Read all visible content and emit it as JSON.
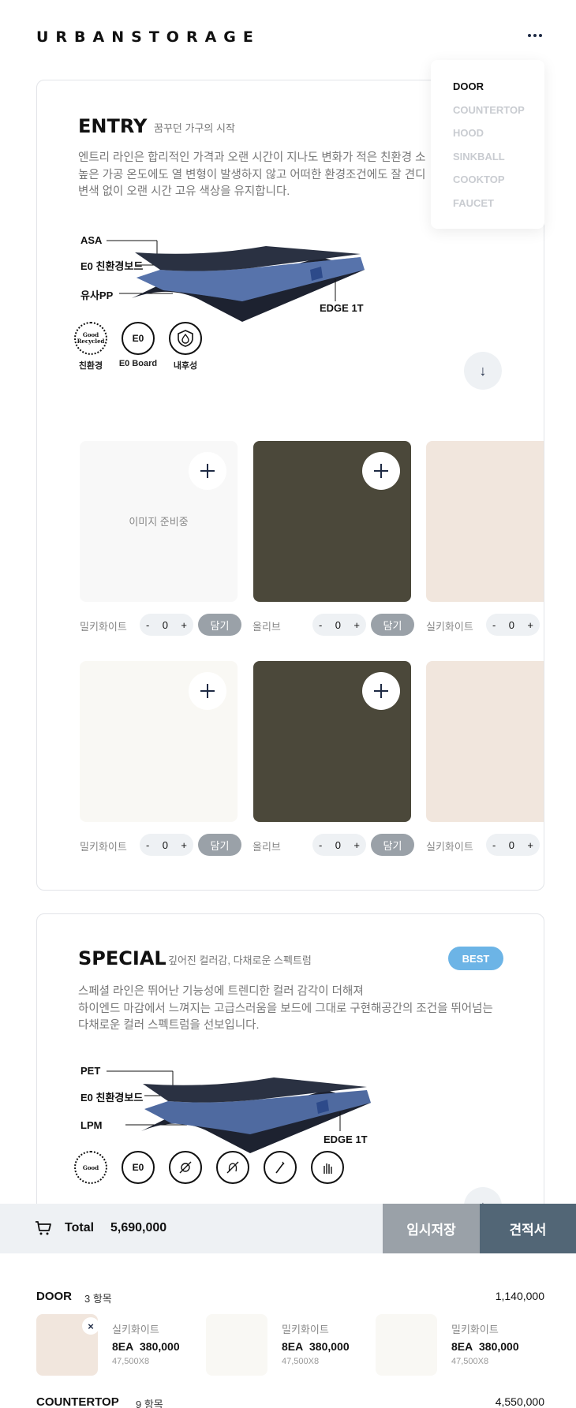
{
  "brand": {
    "logo": "URBANSTORAGE"
  },
  "menu": {
    "items": [
      "DOOR",
      "COUNTERTOP",
      "HOOD",
      "SINKBALL",
      "COOKTOP",
      "FAUCET"
    ],
    "active": "DOOR"
  },
  "entry": {
    "title": "ENTRY",
    "subtitle": "꿈꾸던 가구의 시작",
    "desc": [
      "엔트리 라인은 합리적인 가격과 오랜 시간이 지나도 변화가 적은 친환경 소",
      "높은 가공 온도에도 열 변형이 발생하지 않고 어떠한 환경조건에도 잘 견디",
      "변색 없이 오랜 시간 고유 색상을 유지합니다."
    ],
    "layers": [
      "ASA",
      "E0 친환경보드",
      "유사PP",
      "EDGE 1T"
    ],
    "certs": [
      {
        "icon": "good-recycled-icon",
        "label": "Good Recycled",
        "caption": "친환경"
      },
      {
        "icon": "e0-icon",
        "label": "E0",
        "caption": "E0 Board"
      },
      {
        "icon": "shield-drop-icon",
        "label": "",
        "caption": "내후성"
      }
    ],
    "placeholder": "이미지 준비중",
    "add_label": "담기",
    "options_row1": [
      {
        "name": "밀키화이트",
        "qty": "0",
        "color": "#f8f8f8"
      },
      {
        "name": "올리브",
        "qty": "0",
        "color": "#4b483a"
      },
      {
        "name": "실키화이트",
        "qty": "0",
        "color": "#f1e6dd"
      }
    ],
    "options_row2": [
      {
        "name": "밀키화이트",
        "qty": "0",
        "color": "#f9f8f4"
      },
      {
        "name": "올리브",
        "qty": "0",
        "color": "#4b483a"
      },
      {
        "name": "실키화이트",
        "qty": "0",
        "color": "#f1e6dd"
      }
    ]
  },
  "special": {
    "title": "SPECIAL",
    "subtitle": "깊어진 컬러감, 다채로운 스펙트럼",
    "badge": "BEST",
    "desc": [
      "스페셜 라인은 뛰어난 기능성에 트렌디한 컬러 감각이 더해져",
      "하이엔드 마감에서 느껴지는 고급스러움을 보드에 그대로 구현해공간의 조건을 뛰어넘는",
      "다채로운 컬러 스펙트럼을 선보입니다."
    ],
    "layers": [
      "PET",
      "E0 친환경보드",
      "LPM",
      "EDGE 1T"
    ],
    "cert_labels": [
      "Good",
      "E0"
    ]
  },
  "cart": {
    "total_label": "Total",
    "total_value": "5,690,000",
    "temp_save": "임시저장",
    "quote": "견적서"
  },
  "summary": {
    "door": {
      "name": "DOOR",
      "count": "3 항목",
      "total": "1,140,000",
      "items": [
        {
          "name": "실키화이트",
          "qty": "8EA",
          "price": "380,000",
          "calc": "47,500X8",
          "color": "#f1e6dd",
          "remove": "×"
        },
        {
          "name": "밀키화이트",
          "qty": "8EA",
          "price": "380,000",
          "calc": "47,500X8",
          "color": "#f9f8f4"
        },
        {
          "name": "밀키화이트",
          "qty": "8EA",
          "price": "380,000",
          "calc": "47,500X8",
          "color": "#f9f8f4"
        }
      ]
    },
    "countertop": {
      "name": "COUNTERTOP",
      "count": "9 항목",
      "total": "4,550,000"
    }
  }
}
